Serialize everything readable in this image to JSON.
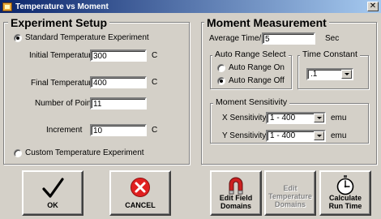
{
  "window": {
    "title": "Temperature vs Moment",
    "close_glyph": "✕"
  },
  "experiment_setup": {
    "title": "Experiment Setup",
    "standard_label": "Standard Temperature Experiment",
    "initial_temp_label": "Initial Temperature",
    "initial_temp_value": "300",
    "final_temp_label": "Final Temperature",
    "final_temp_value": "400",
    "num_points_label": "Number of Points",
    "num_points_value": "11",
    "increment_label": "Increment",
    "increment_value": "10",
    "unit_c": "C",
    "custom_label": "Custom Temperature Experiment"
  },
  "moment_measurement": {
    "title": "Moment Measurement",
    "avg_time_label": "Average Time/pt",
    "avg_time_value": "5",
    "avg_time_unit": "Sec",
    "auto_range": {
      "title": "Auto Range Select",
      "on_label": "Auto Range On",
      "off_label": "Auto Range Off"
    },
    "time_constant": {
      "title": "Time Constant",
      "value": ".1"
    },
    "sensitivity": {
      "title": "Moment Sensitivity",
      "x_label": "X Sensitivity",
      "x_value": "1 - 400",
      "y_label": "Y Sensitivity",
      "y_value": "1 - 400",
      "unit": "emu"
    }
  },
  "buttons": {
    "ok": "OK",
    "cancel": "CANCEL",
    "edit_field_1": "Edit Field",
    "edit_field_2": "Domains",
    "edit_temp_1": "Edit",
    "edit_temp_2": "Temperature",
    "edit_temp_3": "Domains",
    "calc_1": "Calculate",
    "calc_2": "Run Time"
  },
  "colors": {
    "titlebar_start": "#0a246a",
    "titlebar_end": "#a6caf0",
    "face": "#d4d0c8",
    "ok_check": "#000000",
    "cancel_red": "#e02020",
    "magnet_red": "#cc2020"
  }
}
